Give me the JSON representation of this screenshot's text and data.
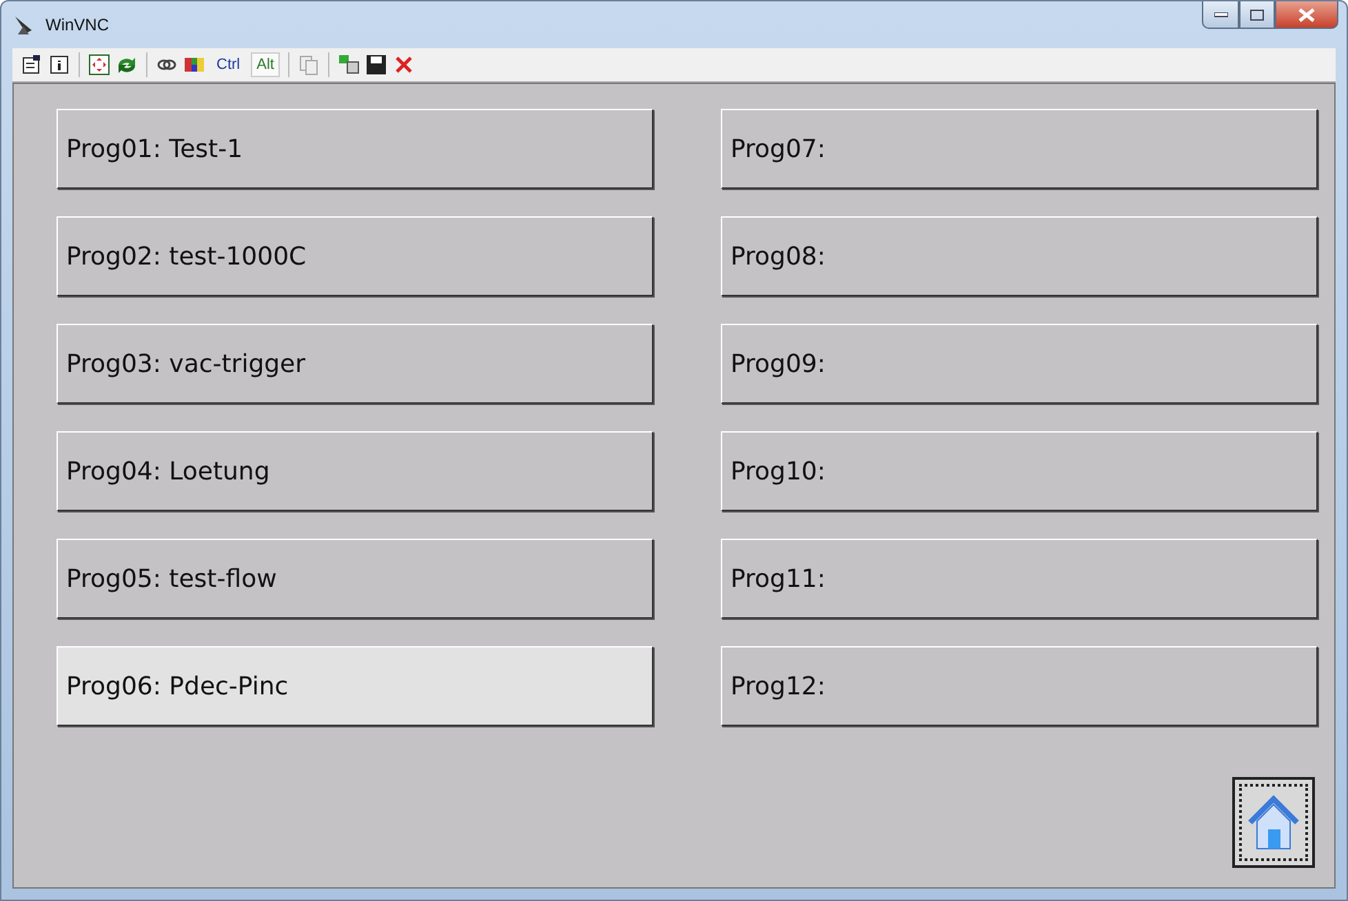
{
  "window": {
    "title": "WinVNC"
  },
  "toolbar": {
    "keys": [
      {
        "label": "Ctrl",
        "selected": false
      },
      {
        "label": "Alt",
        "selected": true
      }
    ]
  },
  "programs": [
    {
      "label": "Prog01: Test-1",
      "selected": false
    },
    {
      "label": "Prog02: test-1000C",
      "selected": false
    },
    {
      "label": "Prog03: vac-trigger",
      "selected": false
    },
    {
      "label": "Prog04: Loetung",
      "selected": false
    },
    {
      "label": "Prog05: test-flow",
      "selected": false
    },
    {
      "label": "Prog06: Pdec-Pinc",
      "selected": true
    },
    {
      "label": "Prog07:",
      "selected": false
    },
    {
      "label": "Prog08:",
      "selected": false
    },
    {
      "label": "Prog09:",
      "selected": false
    },
    {
      "label": "Prog10:",
      "selected": false
    },
    {
      "label": "Prog11:",
      "selected": false
    },
    {
      "label": "Prog12:",
      "selected": false
    }
  ]
}
